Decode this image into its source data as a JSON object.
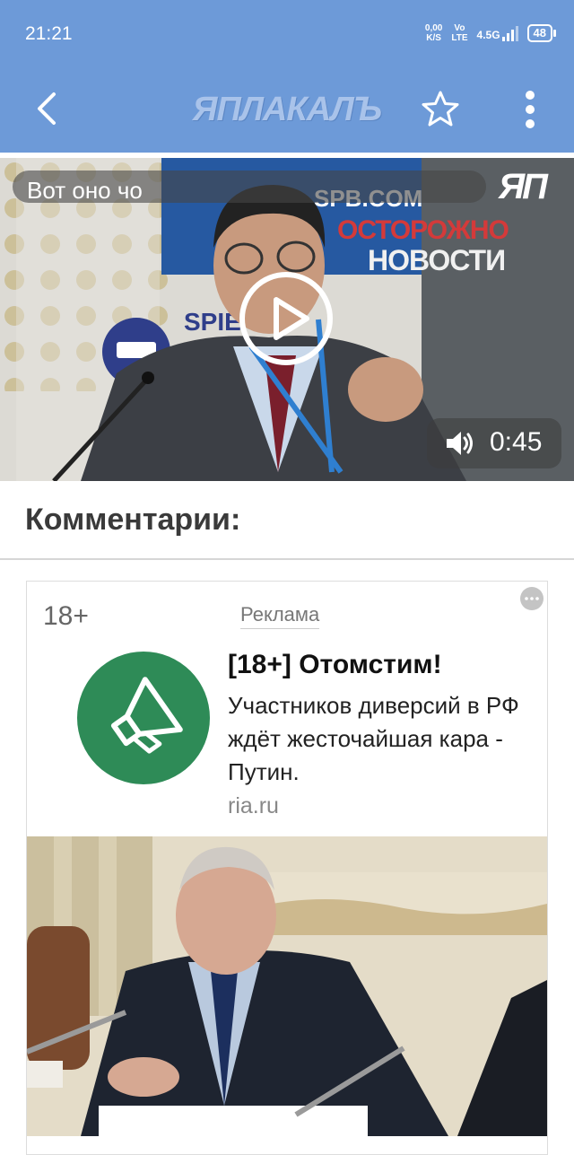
{
  "status_bar": {
    "time": "21:21",
    "net_speed_value": "0,00",
    "net_speed_unit": "K/S",
    "net_type_top": "Vo",
    "net_type_bottom": "LTE",
    "signal": "4.5G",
    "battery": "48"
  },
  "app_bar": {
    "logo_text": "ЯПЛАКАЛЪ",
    "back_icon": "chevron-left-icon",
    "star_icon": "star-outline-icon",
    "menu_icon": "more-vertical-icon",
    "color": "#6d9ad8"
  },
  "video": {
    "title": "Вот оно чо",
    "watermark": "ЯП",
    "banner_site": "SPB.COM",
    "banner_top": "ОСТОРОЖНО",
    "banner_bottom": "НОВОСТИ",
    "duration": "0:45",
    "play_icon": "play-circle-icon",
    "volume_icon": "volume-icon"
  },
  "comments": {
    "title": "Комментарии:"
  },
  "ad": {
    "age": "18+",
    "label": "Реклама",
    "headline": "[18+] Отомстим!",
    "text": "Участников диверсий в РФ ждёт жесточайшая кара - Путин.",
    "domain": "ria.ru",
    "icon": "megaphone-icon",
    "icon_color": "#2e8b57",
    "more_icon": "more-horizontal-icon"
  }
}
